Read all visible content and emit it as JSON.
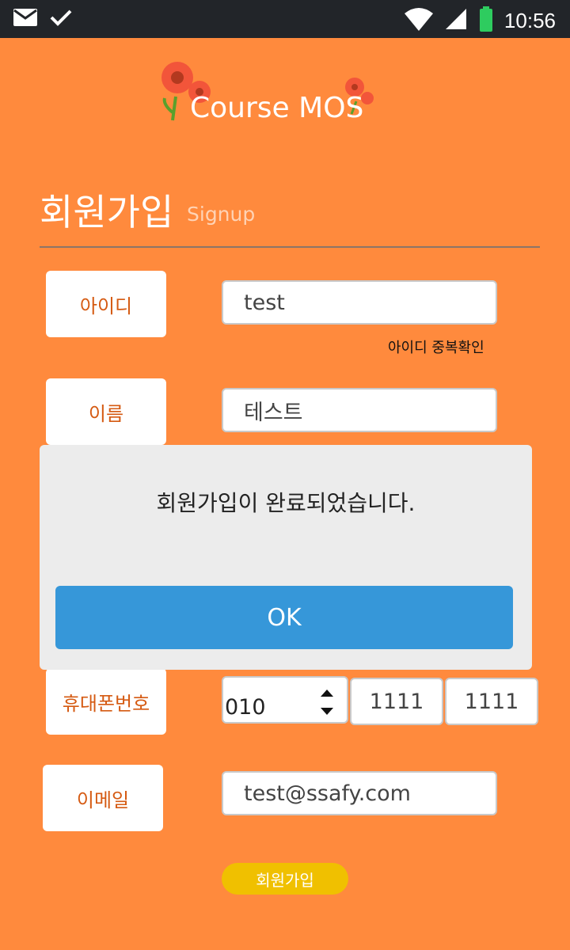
{
  "status_bar": {
    "time": "10:56"
  },
  "logo": {
    "text": "Course MOS"
  },
  "page": {
    "title": "회원가입",
    "subtitle": "Signup"
  },
  "form": {
    "id": {
      "label": "아이디",
      "value": "test",
      "hint": "아이디 중복확인"
    },
    "name": {
      "label": "이름",
      "value": "테스트"
    },
    "phone": {
      "label": "휴대폰번호",
      "prefix": "010",
      "mid": "1111",
      "last": "1111"
    },
    "email": {
      "label": "이메일",
      "value": "test@ssafy.com"
    },
    "submit_label": "회원가입"
  },
  "dialog": {
    "message": "회원가입이 완료되었습니다.",
    "ok_label": "OK"
  },
  "colors": {
    "background": "#ff8a3d",
    "label_text": "#d55a12",
    "dialog_button": "#3697d9",
    "submit_button": "#f0c000"
  }
}
